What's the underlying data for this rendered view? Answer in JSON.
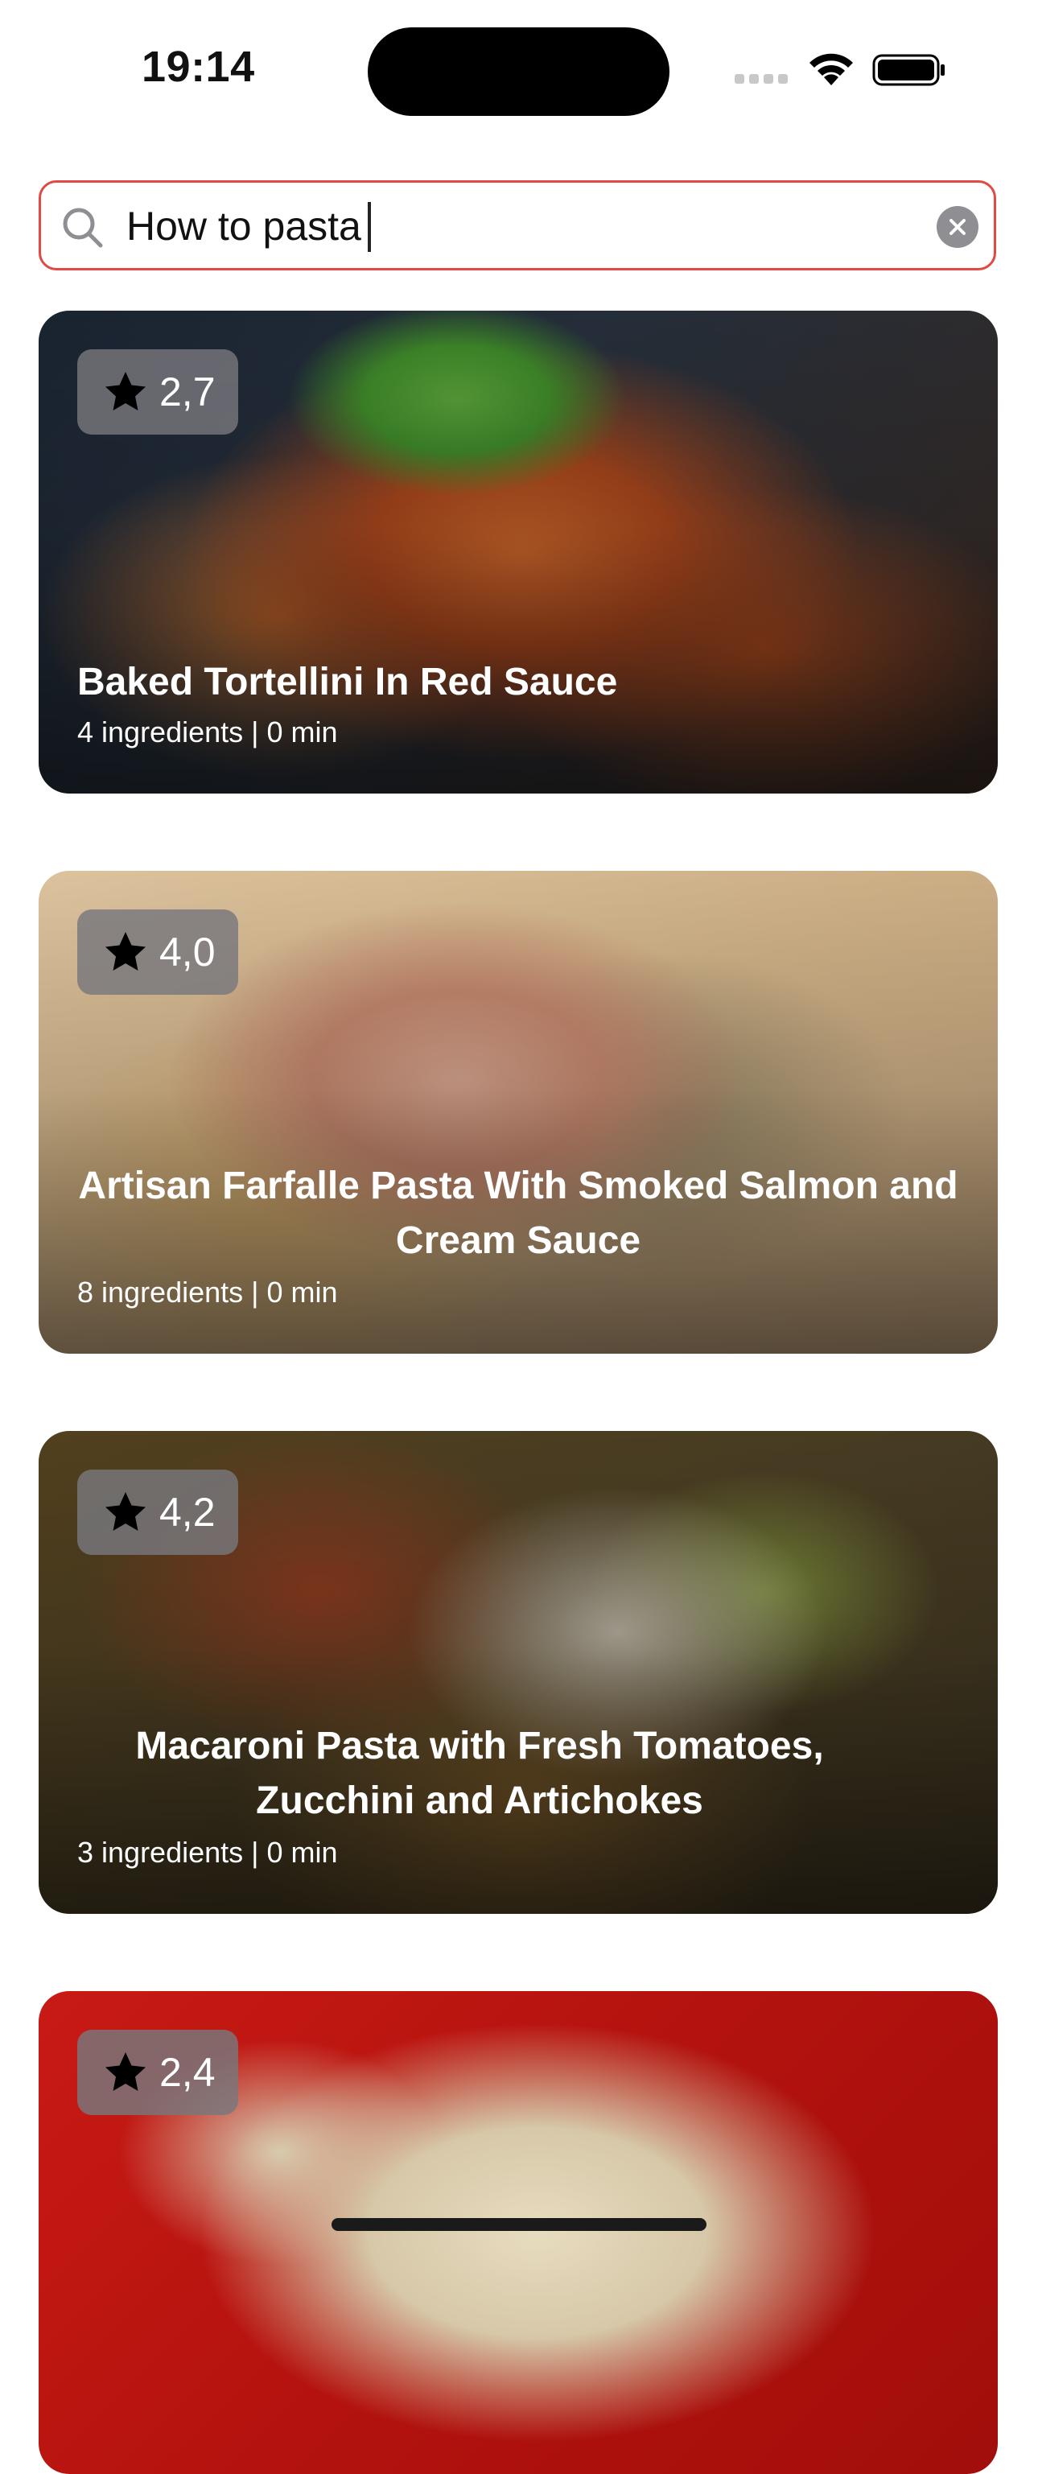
{
  "status_bar": {
    "time": "19:14"
  },
  "search": {
    "value": "How to pasta",
    "placeholder": ""
  },
  "recipes": [
    {
      "rating": "2,7",
      "title": "Baked Tortellini In Red Sauce",
      "meta": "4 ingredients | 0 min"
    },
    {
      "rating": "4,0",
      "title": "Artisan Farfalle Pasta With Smoked Salmon and Cream Sauce",
      "meta": "8 ingredients | 0 min"
    },
    {
      "rating": "4,2",
      "title": "Macaroni Pasta with Fresh Tomatoes, Zucchini and Artichokes",
      "meta": "3 ingredients | 0 min"
    },
    {
      "rating": "2,4"
    }
  ],
  "colors": {
    "search_border": "#e04a43",
    "badge_bg": "#78787d",
    "text_on_image": "#ffffff"
  },
  "icons": {
    "search": "magnifier-icon",
    "clear": "clear-x-icon",
    "rating": "star-icon"
  }
}
